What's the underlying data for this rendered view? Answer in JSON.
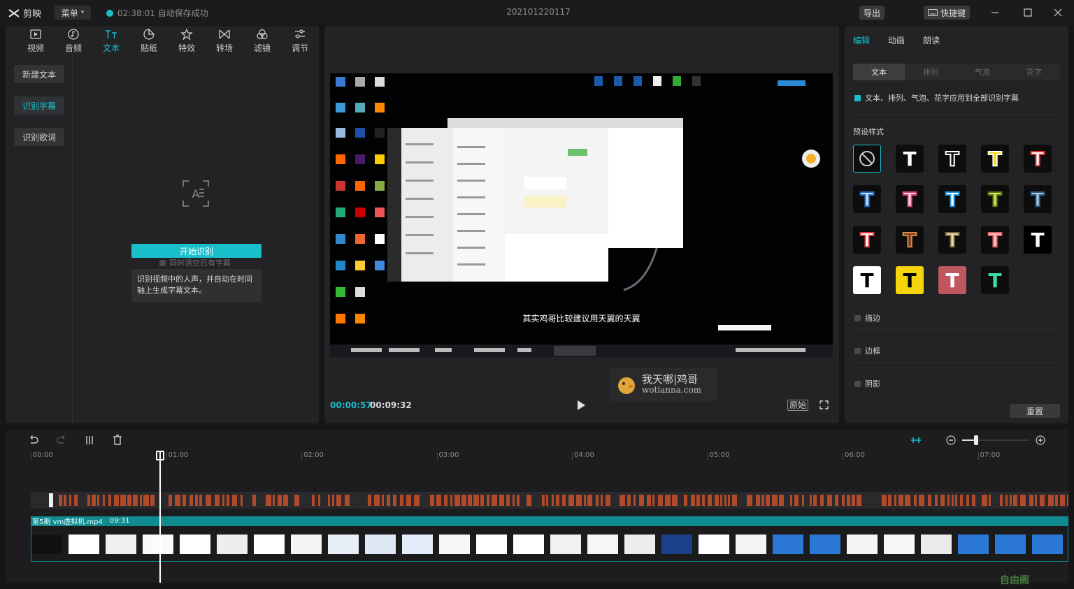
{
  "app": {
    "logo_text": "剪映",
    "menu_label": "菜单",
    "autosave_text": "02:38:01 自动保存成功",
    "project_title": "202101220117",
    "export_label": "导出",
    "shortcut_label": "快捷键"
  },
  "tool_tabs": [
    {
      "label": "视频",
      "icon": "video-icon"
    },
    {
      "label": "音频",
      "icon": "audio-icon"
    },
    {
      "label": "文本",
      "icon": "text-icon",
      "active": true
    },
    {
      "label": "贴纸",
      "icon": "sticker-icon"
    },
    {
      "label": "特效",
      "icon": "effect-icon"
    },
    {
      "label": "转场",
      "icon": "transition-icon"
    },
    {
      "label": "滤镜",
      "icon": "filter-icon"
    },
    {
      "label": "调节",
      "icon": "adjust-icon"
    }
  ],
  "left_nav": {
    "new_text": "新建文本",
    "recognize_subtitles": "识别字幕",
    "recognize_lyrics": "识别歌词"
  },
  "recognition": {
    "clear_existing": "同时清空已有字幕",
    "start_button": "开始识别",
    "tip": "识别视频中的人声，并自动在时间轴上生成字幕文本。"
  },
  "player": {
    "subtitle": "其实鸡哥比较建议用天翼的天翼",
    "time_current": "00:00:57",
    "time_total": "00:09:32",
    "ratio_label": "原始",
    "watermark_title": "我天哪|鸡哥",
    "watermark_url": "wotianna.com"
  },
  "right_panel": {
    "tabs": [
      "编辑",
      "动画",
      "朗读"
    ],
    "sub_tabs": [
      "文本",
      "排列",
      "气泡",
      "花字"
    ],
    "apply_all": "文本、排列、气泡、花字应用到全部识别字幕",
    "preset_label": "预设样式",
    "presets": [
      {
        "glyph": "⃠",
        "fg": "#cfcfd1",
        "bg": "#0d0d0e",
        "stroke": "",
        "selected": true
      },
      {
        "glyph": "T",
        "fg": "#ffffff",
        "bg": "#0d0d0e",
        "stroke": ""
      },
      {
        "glyph": "T",
        "fg": "#0d0d0e",
        "bg": "#0d0d0e",
        "stroke": "#ffffff"
      },
      {
        "glyph": "T",
        "fg": "#f5d40a",
        "bg": "#0d0d0e",
        "stroke": "#ffffff"
      },
      {
        "glyph": "T",
        "fg": "#ffffff",
        "bg": "#0d0d0e",
        "stroke": "#e0353a"
      },
      {
        "glyph": "T",
        "fg": "#bfe0ff",
        "bg": "#0d0d0e",
        "stroke": "#2b6dc4"
      },
      {
        "glyph": "T",
        "fg": "#ffd0e8",
        "bg": "#0d0d0e",
        "stroke": "#e0457a"
      },
      {
        "glyph": "T",
        "fg": "#ffffff",
        "bg": "#0d0d0e",
        "stroke": "#1e9be6"
      },
      {
        "glyph": "T",
        "fg": "#d8e84a",
        "bg": "#0d0d0e",
        "stroke": "#5a7a1a"
      },
      {
        "glyph": "T",
        "fg": "#9fc8e0",
        "bg": "#0d0d0e",
        "stroke": "#2f5f85"
      },
      {
        "glyph": "T",
        "fg": "#ffffff",
        "bg": "#0d0d0e",
        "stroke": "#e0353a"
      },
      {
        "glyph": "T",
        "fg": "#7a3a1a",
        "bg": "#0d0d0e",
        "stroke": "#d58a4a"
      },
      {
        "glyph": "T",
        "fg": "#e8dcb8",
        "bg": "#0d0d0e",
        "stroke": "#7a6a40"
      },
      {
        "glyph": "T",
        "fg": "#ffc0c0",
        "bg": "#0d0d0e",
        "stroke": "#e0606a"
      },
      {
        "glyph": "T",
        "fg": "#ffffff",
        "bg": "#000000",
        "stroke": ""
      },
      {
        "glyph": "T",
        "fg": "#000000",
        "bg": "#ffffff",
        "stroke": ""
      },
      {
        "glyph": "T",
        "fg": "#000000",
        "bg": "#f5d40a",
        "stroke": ""
      },
      {
        "glyph": "T",
        "fg": "#ffffff",
        "bg": "#c0575e",
        "stroke": ""
      },
      {
        "glyph": "T",
        "fg": "#3cdca0",
        "bg": "#0d0d0e",
        "stroke": ""
      }
    ],
    "options": [
      "描边",
      "边框",
      "阴影"
    ],
    "reset_label": "重置"
  },
  "timeline": {
    "ruler_labels": [
      "00:00",
      "01:00",
      "02:00",
      "03:00",
      "04:00",
      "05:00",
      "06:00",
      "07:00"
    ],
    "clip_name": "第5期 vm虚拟机.mp4",
    "clip_duration": "09:31"
  },
  "brand_watermark": "自由阁",
  "colors": {
    "accent": "#19c0cc",
    "track": "#0f8a8f",
    "audio_bar": "#b04a2a"
  }
}
